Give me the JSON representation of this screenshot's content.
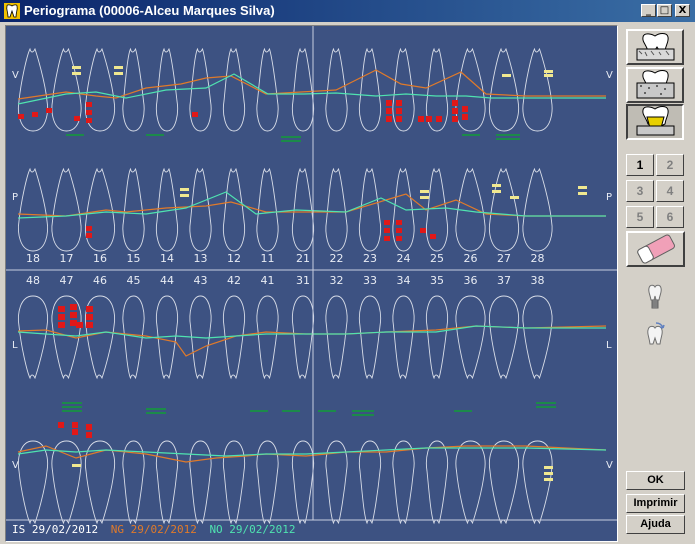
{
  "window": {
    "title": "Periograma (00006-Alceu Marques Silva)"
  },
  "window_controls": {
    "minimize": "_",
    "maximize": "□",
    "close": "X"
  },
  "upper_numbers": [
    "18",
    "17",
    "16",
    "15",
    "14",
    "13",
    "12",
    "11",
    "21",
    "22",
    "23",
    "24",
    "25",
    "26",
    "27",
    "28"
  ],
  "lower_numbers": [
    "48",
    "47",
    "46",
    "45",
    "44",
    "43",
    "42",
    "41",
    "31",
    "32",
    "33",
    "34",
    "35",
    "36",
    "37",
    "38"
  ],
  "side_labels": {
    "upper_top": "V",
    "upper_bottom": "P",
    "lower_top": "L",
    "lower_bottom": "V"
  },
  "legend": {
    "is": "IS 29/02/2012",
    "ng": "NG 29/02/2012",
    "no": "NO 29/02/2012"
  },
  "number_buttons": [
    "1",
    "2",
    "3",
    "4",
    "5",
    "6"
  ],
  "buttons": {
    "ok": "OK",
    "print": "Imprimir",
    "help": "Ajuda"
  },
  "colors": {
    "chart_bg": "#3d5282",
    "tooth_line": "#d8dde8",
    "ng_line": "#e07a2a",
    "no_line": "#4fe3b0",
    "is_mark": "#e01818",
    "plaque_mark": "#f0e890",
    "furcation_mark": "#1c8a4a",
    "legend_is": "#ffffff",
    "legend_ng": "#e07a2a",
    "legend_no": "#4fe3b0"
  }
}
